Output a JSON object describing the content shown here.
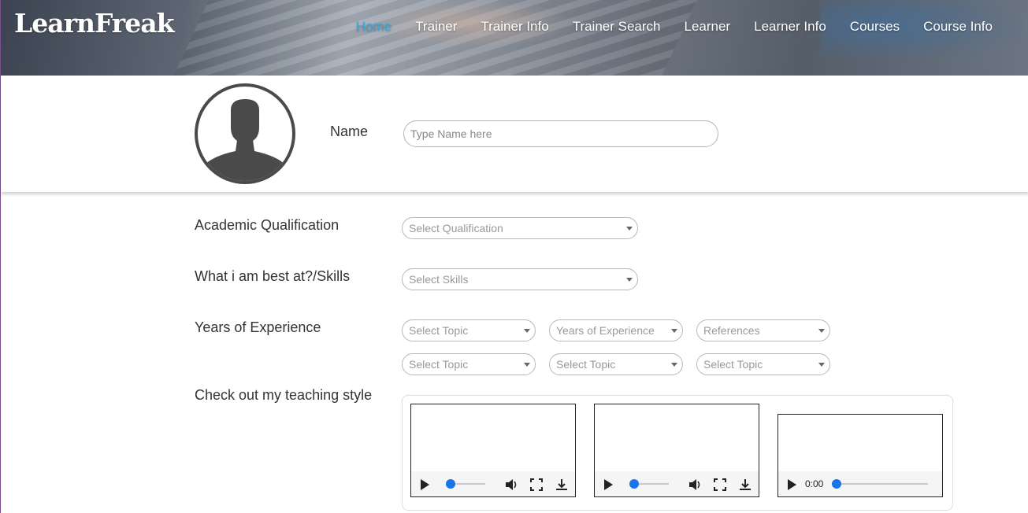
{
  "app": {
    "logo": "LearnFreak"
  },
  "nav": {
    "items": [
      {
        "label": "Home",
        "active": true
      },
      {
        "label": "Trainer"
      },
      {
        "label": "Trainer Info"
      },
      {
        "label": "Trainer Search"
      },
      {
        "label": "Learner"
      },
      {
        "label": "Learner Info"
      },
      {
        "label": "Courses"
      },
      {
        "label": "Course Info"
      }
    ],
    "active_color": "#3aa8e0"
  },
  "profile": {
    "avatar_icon": "user-silhouette-icon",
    "name_label": "Name",
    "name_placeholder": "Type Name here",
    "name_value": ""
  },
  "form": {
    "qualification": {
      "label": "Academic Qualification",
      "placeholder": "Select Qualification"
    },
    "skills": {
      "label": "What i am best at?/Skills",
      "placeholder": "Select Skills"
    },
    "experience": {
      "label": "Years of Experience",
      "row1": [
        "Select Topic",
        "Years of Experience",
        "References"
      ],
      "row2": [
        "Select Topic",
        "Select Topic",
        "Select Topic"
      ]
    },
    "teaching": {
      "label": "Check out my teaching style",
      "videos": [
        {
          "type": "video",
          "progress": 0
        },
        {
          "type": "video",
          "progress": 0
        },
        {
          "type": "audio",
          "time": "0:00",
          "progress": 0
        }
      ]
    }
  },
  "colors": {
    "accent": "#1a73e8",
    "text": "#333333"
  }
}
